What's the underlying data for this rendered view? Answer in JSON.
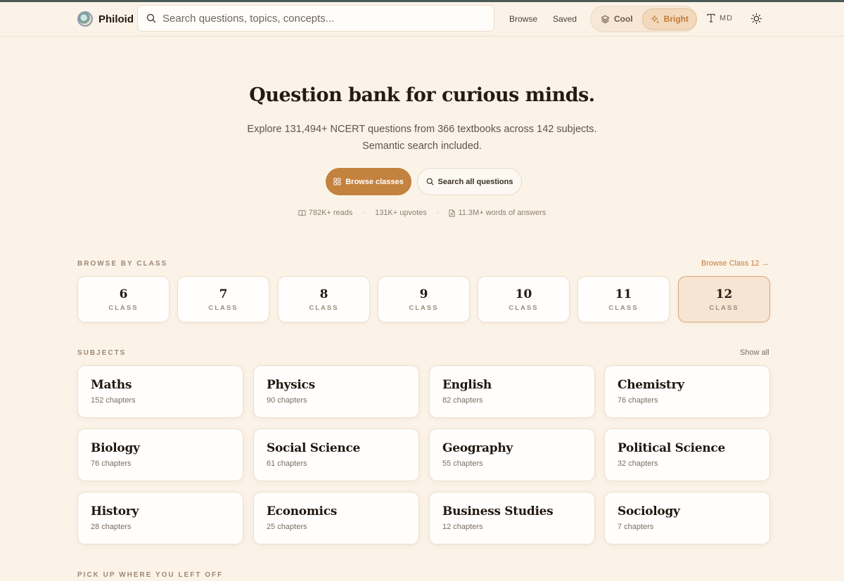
{
  "app": {
    "name": "Philoid"
  },
  "header": {
    "search_placeholder": "Search questions, topics, concepts...",
    "nav": [
      "Browse",
      "Saved"
    ],
    "theme": {
      "cool": "Cool",
      "bright": "Bright",
      "active": "Bright"
    },
    "font_size": "MD",
    "accent_color": "#c4823f"
  },
  "hero": {
    "title": "Question bank for curious minds.",
    "subtitle_line1": "Explore 131,494+ NCERT questions from 366 textbooks across 142 subjects.",
    "subtitle_line2": "Semantic search included.",
    "primary_cta": "Browse classes",
    "secondary_cta": "Search all questions",
    "stats": {
      "reads": "782K+ reads",
      "upvotes": "131K+ upvotes",
      "words": "11.3M+ words of answers"
    }
  },
  "browse_by_class": {
    "label": "BROWSE BY CLASS",
    "link": "Browse Class 12 →",
    "class_word": "CLASS",
    "classes": [
      "6",
      "7",
      "8",
      "9",
      "10",
      "11",
      "12"
    ],
    "selected": "12"
  },
  "subjects": {
    "label": "SUBJECTS",
    "show_all": "Show all",
    "items": [
      {
        "name": "Maths",
        "count": "152 chapters"
      },
      {
        "name": "Physics",
        "count": "90 chapters"
      },
      {
        "name": "English",
        "count": "82 chapters"
      },
      {
        "name": "Chemistry",
        "count": "76 chapters"
      },
      {
        "name": "Biology",
        "count": "76 chapters"
      },
      {
        "name": "Social Science",
        "count": "61 chapters"
      },
      {
        "name": "Geography",
        "count": "55 chapters"
      },
      {
        "name": "Political Science",
        "count": "32 chapters"
      },
      {
        "name": "History",
        "count": "28 chapters"
      },
      {
        "name": "Economics",
        "count": "25 chapters"
      },
      {
        "name": "Business Studies",
        "count": "12 chapters"
      },
      {
        "name": "Sociology",
        "count": "7 chapters"
      }
    ]
  },
  "resume": {
    "label": "PICK UP WHERE YOU LEFT OFF"
  }
}
